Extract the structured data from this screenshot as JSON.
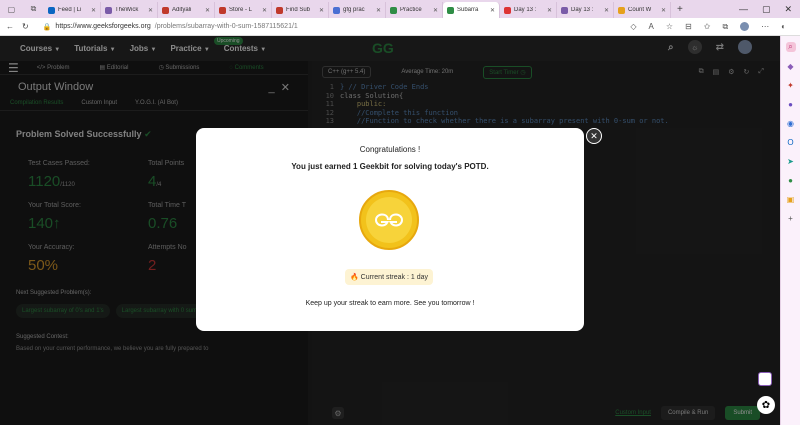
{
  "browser": {
    "tabs": [
      {
        "label": "Feed | Li",
        "color": "#0a66c2"
      },
      {
        "label": "TheWick",
        "color": "#7a5ba8"
      },
      {
        "label": "Adityali",
        "color": "#c0392b"
      },
      {
        "label": "Store - L",
        "color": "#c0392b"
      },
      {
        "label": "Find Sub",
        "color": "#c0392b"
      },
      {
        "label": "gfg prac",
        "color": "#4a6fd3"
      },
      {
        "label": "Practice",
        "color": "#2f8d46"
      },
      {
        "label": "Subarra",
        "color": "#2f8d46",
        "active": true
      },
      {
        "label": "Day 13 :",
        "color": "#d33"
      },
      {
        "label": "Day 13 :",
        "color": "#7a5ba8"
      },
      {
        "label": "Count W",
        "color": "#e6a11c"
      }
    ],
    "url_host": "https://www.geeksforgeeks.org",
    "url_path": "/problems/subarray-with-0-sum-1587115621/1"
  },
  "nav": {
    "items": [
      "Courses",
      "Tutorials",
      "Jobs",
      "Practice",
      "Contests"
    ],
    "upcoming_badge": "Upcoming",
    "logo": "GG"
  },
  "panel": {
    "tabs": [
      "Problem",
      "Editorial",
      "Submissions",
      "Comments"
    ],
    "output_title": "Output Window",
    "subtabs": [
      "Compilation Results",
      "Custom Input",
      "Y.O.G.I. (AI Bot)"
    ],
    "solved_text": "Problem Solved Successfully",
    "stats": [
      {
        "label": "Test Cases Passed:",
        "value": "1120",
        "suffix": "/1120",
        "cls": ""
      },
      {
        "label": "Total Points",
        "value": "4",
        "suffix": "/4",
        "cls": ""
      },
      {
        "label": "Your Total Score:",
        "value": "140",
        "suffix": "",
        "cls": "",
        "arrow": "↑"
      },
      {
        "label": "Total Time T",
        "value": "0.76",
        "suffix": "",
        "cls": ""
      },
      {
        "label": "Your Accuracy:",
        "value": "50%",
        "suffix": "",
        "cls": "orange"
      },
      {
        "label": "Attempts No",
        "value": "2",
        "suffix": "",
        "cls": "red"
      }
    ],
    "next_title": "Next Suggested Problem(s):",
    "suggestions": [
      "Largest subarray of 0's and 1's",
      "Largest subarray with 0 sum",
      "Subarray with given sum"
    ],
    "contest_title": "Suggested Contest:",
    "contest_text": "Based on your current performance, we believe you are fully prepared to"
  },
  "editor": {
    "lang": "C++ (g++ 5.4)",
    "avg_time": "Average Time: 20m",
    "timer": "Start Timer",
    "lines": [
      {
        "n": "1",
        "text": "} // Driver Code Ends",
        "cls": "cm"
      },
      {
        "n": "10",
        "text": "class Solution{",
        "cls": "kw"
      },
      {
        "n": "11",
        "text": "    public:",
        "cls": "pub"
      },
      {
        "n": "12",
        "text": "    //Complete this function",
        "cls": "cm"
      },
      {
        "n": "13",
        "text": "    //Function to check whether there is a subarray present with 0-sum or not.",
        "cls": "cm"
      }
    ],
    "custom_input": "Custom Input",
    "compile_run": "Compile & Run",
    "submit": "Submit"
  },
  "modal": {
    "title": "Congratulations !",
    "subtitle": "You just earned 1 Geekbit for solving today's POTD.",
    "streak": "Current streak : 1 day",
    "footer": "Keep up your streak to earn more. See you tomorrow !"
  }
}
